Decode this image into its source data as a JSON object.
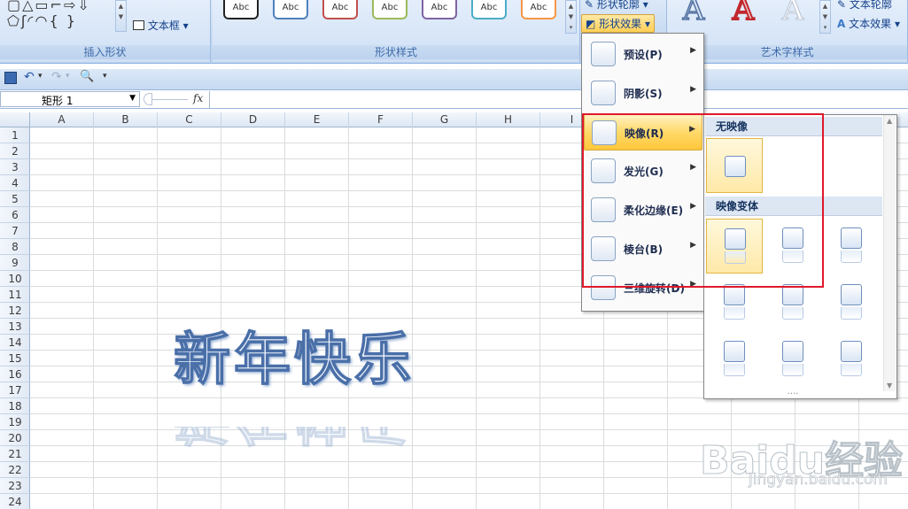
{
  "ribbon": {
    "groups": {
      "insert_shapes": "插入形状",
      "shape_styles": "形状样式",
      "wordart_styles": "艺术字样式"
    },
    "text_box": "文本框",
    "shape_outline": "形状轮廓",
    "shape_effects": "形状效果",
    "text_outline": "文本轮廓",
    "text_effects": "文本效果",
    "style_swatches": [
      "Abc",
      "Abc",
      "Abc",
      "Abc",
      "Abc",
      "Abc",
      "Abc"
    ],
    "swatch_colors": [
      "#222222",
      "#4f81bd",
      "#c0504d",
      "#9bbb59",
      "#8064a2",
      "#4bacc6",
      "#f79646"
    ],
    "wordart_letters": [
      "A",
      "A",
      "A"
    ]
  },
  "formula_bar": {
    "name_box": "矩形 1",
    "fx": "fx"
  },
  "sheet": {
    "columns": [
      "A",
      "B",
      "C",
      "D",
      "E",
      "F",
      "G",
      "H",
      "I"
    ],
    "rows": [
      "1",
      "2",
      "3",
      "4",
      "5",
      "6",
      "7",
      "8",
      "9",
      "10",
      "11",
      "12",
      "13",
      "14",
      "15",
      "16",
      "17",
      "18",
      "19",
      "20",
      "21",
      "22",
      "23",
      "24"
    ]
  },
  "wordart_text": "新年快乐",
  "effects_menu": {
    "items": [
      {
        "label": "预设(P)"
      },
      {
        "label": "阴影(S)"
      },
      {
        "label": "映像(R)"
      },
      {
        "label": "发光(G)"
      },
      {
        "label": "柔化边缘(E)"
      },
      {
        "label": "棱台(B)"
      },
      {
        "label": "三维旋转(D)"
      }
    ],
    "active_index": 2
  },
  "reflection_submenu": {
    "no_reflection": "无映像",
    "variations": "映像变体",
    "more": "...."
  },
  "watermark": {
    "brand": "Baidu经验",
    "url": "jingyan.baidu.com"
  }
}
